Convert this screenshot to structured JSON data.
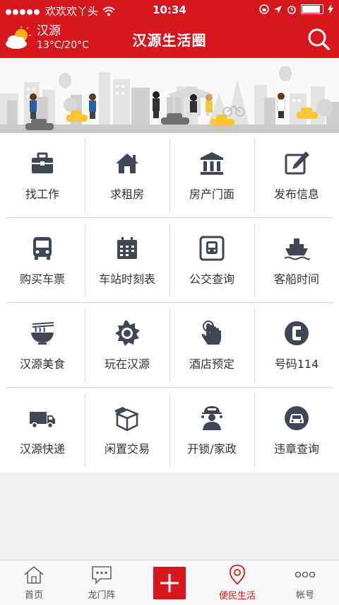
{
  "status_bar": {
    "carrier": "欢欢欢丫头",
    "time": "10:34"
  },
  "header": {
    "city": "汉源",
    "temperature": "13°C/20°C",
    "title": "汉源生活圈"
  },
  "grid": [
    {
      "label": "找工作",
      "icon": "briefcase-icon"
    },
    {
      "label": "求租房",
      "icon": "house-icon"
    },
    {
      "label": "房产门面",
      "icon": "building-icon"
    },
    {
      "label": "发布信息",
      "icon": "edit-icon"
    },
    {
      "label": "购买车票",
      "icon": "bus-icon"
    },
    {
      "label": "车站时刻表",
      "icon": "calendar-icon"
    },
    {
      "label": "公交查询",
      "icon": "bus-stop-icon"
    },
    {
      "label": "客船时间",
      "icon": "ship-icon"
    },
    {
      "label": "汉源美食",
      "icon": "noodle-bowl-icon"
    },
    {
      "label": "玩在汉源",
      "icon": "sun-icon"
    },
    {
      "label": "酒店预定",
      "icon": "touch-icon"
    },
    {
      "label": "号码114",
      "icon": "phone-icon"
    },
    {
      "label": "汉源快递",
      "icon": "truck-icon"
    },
    {
      "label": "闲置交易",
      "icon": "box-icon"
    },
    {
      "label": "开锁/家政",
      "icon": "worker-icon"
    },
    {
      "label": "违章查询",
      "icon": "car-icon"
    }
  ],
  "tabbar": [
    {
      "label": "首页",
      "icon": "home-icon"
    },
    {
      "label": "龙门阵",
      "icon": "chat-icon"
    },
    {
      "label": "",
      "icon": "plus-icon"
    },
    {
      "label": "便民生活",
      "icon": "location-icon",
      "active": true
    },
    {
      "label": "帐号",
      "icon": "more-icon"
    }
  ],
  "colors": {
    "brand_red": "#d6171d",
    "icon_dark": "#3f4756",
    "text": "#333333"
  }
}
